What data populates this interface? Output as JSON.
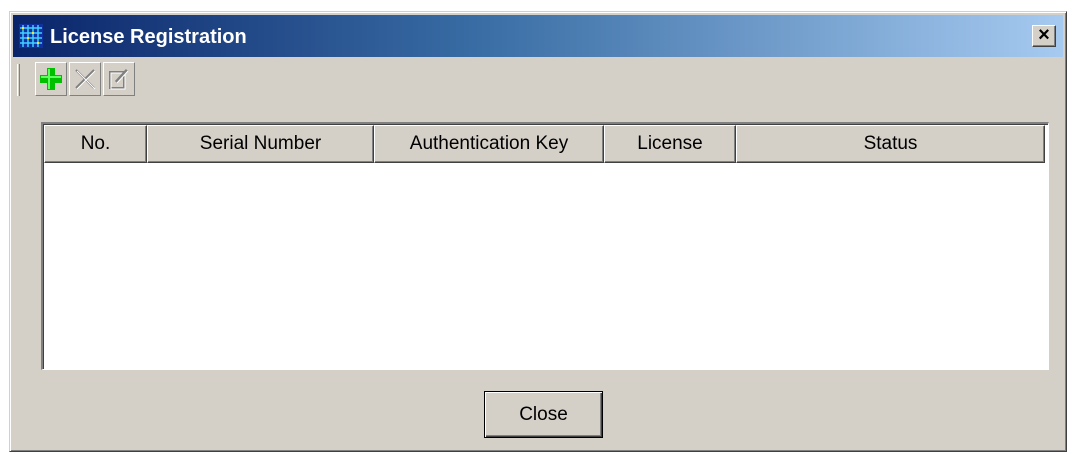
{
  "window": {
    "title": "License Registration",
    "close_glyph": "×",
    "icon": "grid-app-icon"
  },
  "toolbar": {
    "buttons": [
      {
        "name": "add",
        "icon": "plus-icon",
        "color": "#00c000",
        "enabled": true
      },
      {
        "name": "delete",
        "icon": "x-icon",
        "enabled": false
      },
      {
        "name": "edit",
        "icon": "edit-icon",
        "enabled": false
      }
    ]
  },
  "table": {
    "columns": [
      "No.",
      "Serial Number",
      "Authentication Key",
      "License",
      "Status"
    ],
    "rows": []
  },
  "footer": {
    "close_label": "Close"
  },
  "colors": {
    "titlebar_start": "#0a246a",
    "titlebar_end": "#a6caf0",
    "dialog_bg": "#d4d0c8"
  }
}
